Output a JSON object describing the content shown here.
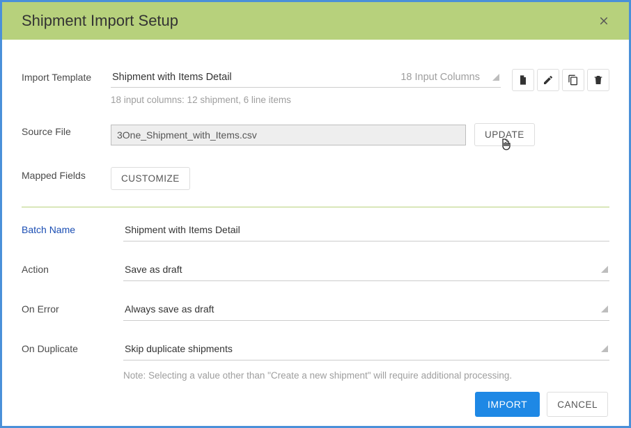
{
  "title": "Shipment Import Setup",
  "importTemplate": {
    "label": "Import Template",
    "value": "Shipment with Items Detail",
    "columns": "18 Input Columns",
    "helper": "18 input columns: 12 shipment, 6 line items"
  },
  "sourceFile": {
    "label": "Source File",
    "value": "3One_Shipment_with_Items.csv",
    "updateLabel": "UPDATE"
  },
  "mappedFields": {
    "label": "Mapped Fields",
    "customizeLabel": "CUSTOMIZE"
  },
  "batchName": {
    "label": "Batch Name",
    "value": "Shipment with Items Detail"
  },
  "action": {
    "label": "Action",
    "value": "Save as draft"
  },
  "onError": {
    "label": "On Error",
    "value": "Always save as draft"
  },
  "onDuplicate": {
    "label": "On Duplicate",
    "value": "Skip duplicate shipments",
    "note": "Note: Selecting a value other than \"Create a new shipment\" will require additional processing."
  },
  "footer": {
    "import": "IMPORT",
    "cancel": "CANCEL"
  }
}
